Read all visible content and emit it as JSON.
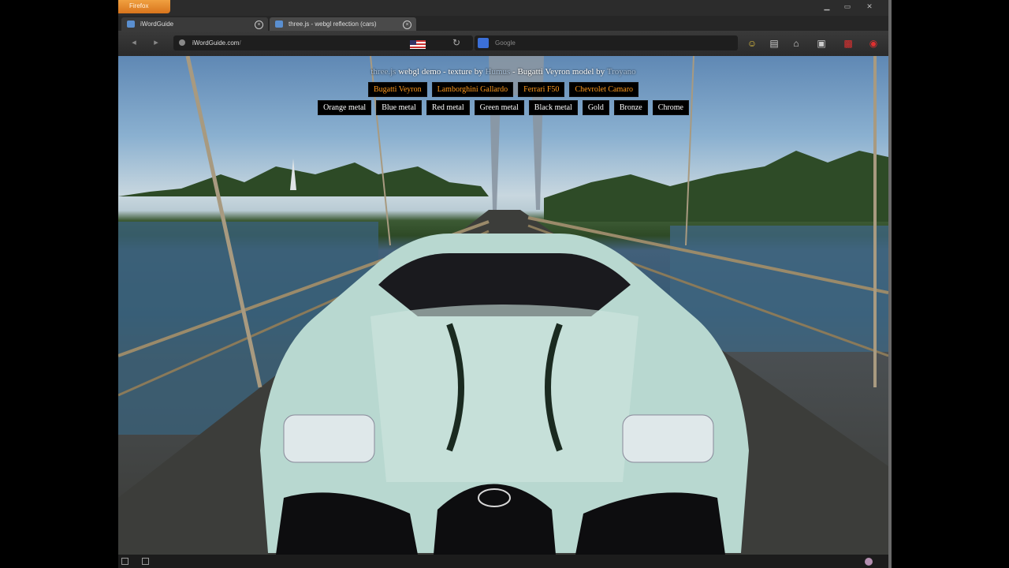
{
  "browser": {
    "app_button_label": "Firefox",
    "tabs": [
      {
        "title": "iWordGuide",
        "active": false
      },
      {
        "title": "three.js - webgl reflection (cars)",
        "active": true
      }
    ],
    "new_tab_label": "+",
    "address": {
      "host": "iWordGuide.com",
      "rest": "/"
    },
    "search": {
      "placeholder": "Google"
    },
    "accent_color": "#e8862a"
  },
  "page": {
    "credit": {
      "prefix": "three.js",
      "webgl": "webgl demo",
      "texture": "texture by",
      "author": "Humus",
      "model": "Bugatti Veyron model by",
      "model_author": "Troyano"
    },
    "car_buttons": [
      "Bugatti Veyron",
      "Lamborghini Gallardo",
      "Ferrari F50",
      "Chevrolet Camaro"
    ],
    "material_buttons": [
      "Orange metal",
      "Blue metal",
      "Red metal",
      "Green metal",
      "Black metal",
      "Gold",
      "Bronze",
      "Chrome"
    ],
    "car_button_color": "#ff9a1e",
    "material_button_color": "#ffffff"
  }
}
